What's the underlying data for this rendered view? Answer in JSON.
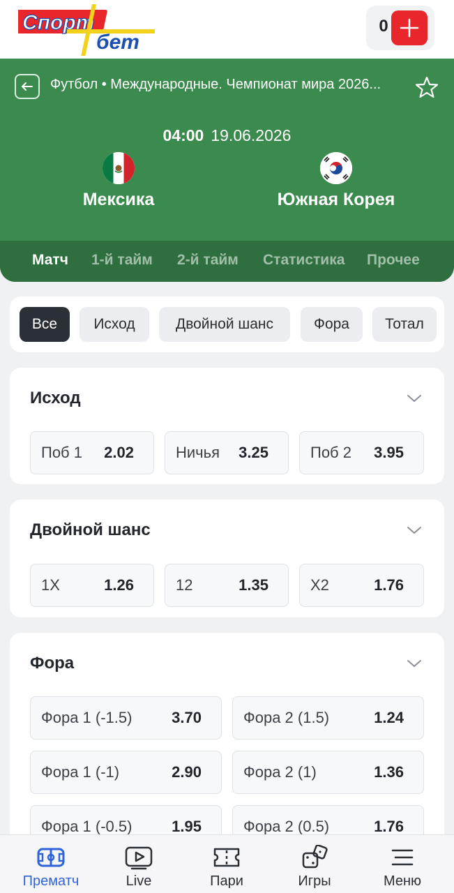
{
  "header": {
    "logo_text_top": "Спорт",
    "logo_text_bottom": "бет",
    "balance": "0",
    "add_icon": "plus-icon"
  },
  "match": {
    "breadcrumb": "Футбол • Международные. Чемпионат мира 2026...",
    "time": "04:00",
    "date": "19.06.2026",
    "team1": "Мексика",
    "team2": "Южная Корея",
    "tabs": [
      {
        "label": "Матч",
        "active": true
      },
      {
        "label": "1-й тайм",
        "active": false
      },
      {
        "label": "2-й тайм",
        "active": false
      },
      {
        "label": "Статистика",
        "active": false
      },
      {
        "label": "Прочее",
        "active": false
      }
    ]
  },
  "filters": [
    {
      "label": "Все",
      "active": true
    },
    {
      "label": "Исход",
      "active": false
    },
    {
      "label": "Двойной шанс",
      "active": false
    },
    {
      "label": "Фора",
      "active": false
    },
    {
      "label": "Тотал",
      "active": false
    }
  ],
  "markets": [
    {
      "title": "Исход",
      "odds": [
        {
          "label": "Поб 1",
          "value": "2.02"
        },
        {
          "label": "Ничья",
          "value": "3.25"
        },
        {
          "label": "Поб 2",
          "value": "3.95"
        }
      ]
    },
    {
      "title": "Двойной шанс",
      "odds": [
        {
          "label": "1X",
          "value": "1.26"
        },
        {
          "label": "12",
          "value": "1.35"
        },
        {
          "label": "X2",
          "value": "1.76"
        }
      ]
    },
    {
      "title": "Фора",
      "odds": [
        {
          "label": "Фора 1 (-1.5)",
          "value": "3.70"
        },
        {
          "label": "Фора 2 (1.5)",
          "value": "1.24"
        },
        {
          "label": "Фора 1 (-1)",
          "value": "2.90"
        },
        {
          "label": "Фора 2 (1)",
          "value": "1.36"
        },
        {
          "label": "Фора 1 (-0.5)",
          "value": "1.95"
        },
        {
          "label": "Фора 2 (0.5)",
          "value": "1.76"
        }
      ]
    }
  ],
  "bottom_nav": [
    {
      "label": "Прематч",
      "icon": "stadium-icon",
      "active": true
    },
    {
      "label": "Live",
      "icon": "play-icon",
      "active": false
    },
    {
      "label": "Пари",
      "icon": "ticket-icon",
      "active": false
    },
    {
      "label": "Игры",
      "icon": "dice-icon",
      "active": false
    },
    {
      "label": "Меню",
      "icon": "menu-icon",
      "active": false
    }
  ],
  "colors": {
    "brand_green": "#3b8a4e",
    "accent_red": "#e8262c",
    "active_blue": "#2f63d8"
  }
}
